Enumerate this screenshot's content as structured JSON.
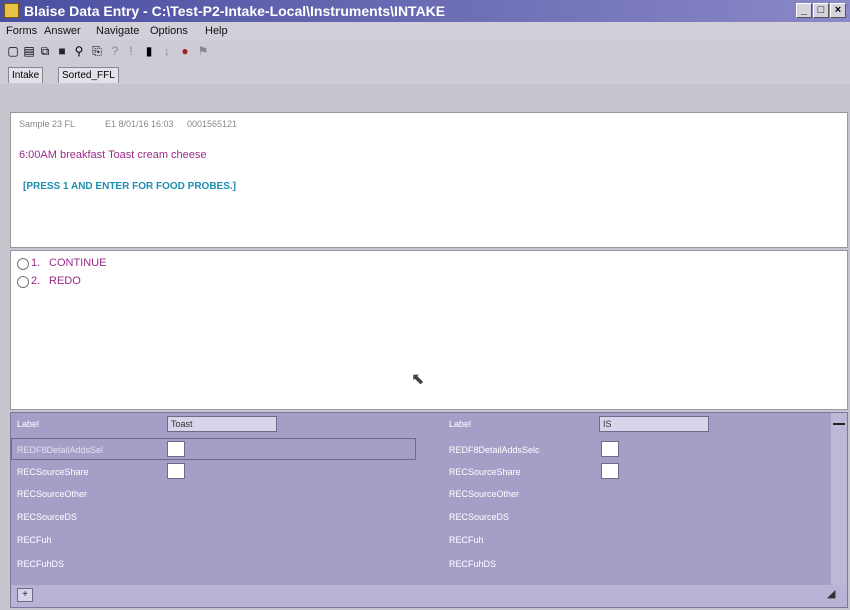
{
  "window": {
    "title": "Blaise Data Entry - C:\\Test-P2-Intake-Local\\Instruments\\INTAKE",
    "btn_min": "_",
    "btn_max": "□",
    "btn_close": "×"
  },
  "menu": [
    "Forms",
    "Answer",
    "Navigate",
    "Options",
    "Help"
  ],
  "toolbar": {
    "icons": [
      "new-icon",
      "open-icon",
      "copy-icon",
      "save-icon",
      "find-icon",
      "preview-icon",
      "help-icon",
      "info-icon",
      "delete-icon",
      "down-icon",
      "watch-icon",
      "flag-icon"
    ]
  },
  "tabs": [
    "Intake",
    "Sorted_FFL"
  ],
  "question": {
    "sample": "Sample 23 FL",
    "time": "E1 8/01/16 16:03",
    "id": "0001565121",
    "food": "6:00AM breakfast Toast cream cheese",
    "instruction": "[PRESS 1 AND ENTER FOR FOOD PROBES.]"
  },
  "answers": [
    {
      "num": "1.",
      "label": "CONTINUE"
    },
    {
      "num": "2.",
      "label": "REDO"
    }
  ],
  "grid": {
    "left": {
      "label_header": "Label",
      "label_value": "Toast",
      "rows": [
        "REDF8DetailAddsSel",
        "RECSourceShare",
        "RECSourceOther",
        "RECSourceDS",
        "RECFuh",
        "RECFuhDS"
      ]
    },
    "right": {
      "label_header": "Label",
      "label_value": "IS",
      "rows": [
        "REDF8DetailAddsSelc",
        "RECSourceShare",
        "RECSourceOther",
        "RECSourceDS",
        "RECFuh",
        "RECFuhDS"
      ]
    }
  },
  "status": {
    "corner_icon": "expand-icon"
  }
}
